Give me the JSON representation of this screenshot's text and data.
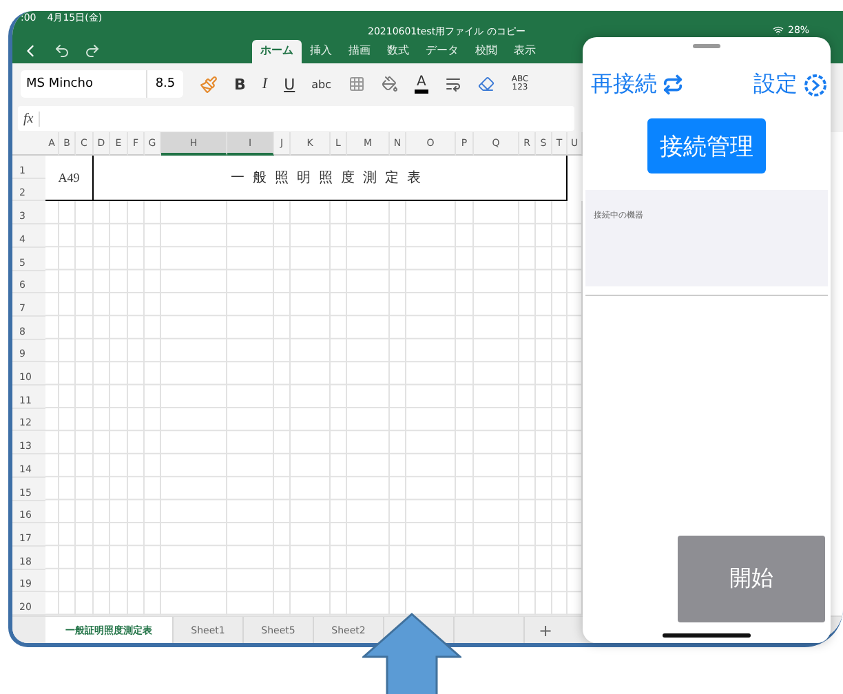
{
  "status_bar": {
    "time": ":00",
    "date": "4月15日(金)",
    "battery": "28%"
  },
  "document_title": "20210601test用ファイル のコピー",
  "ribbon_tabs": [
    {
      "label": "ホーム",
      "selected": true
    },
    {
      "label": "挿入",
      "selected": false
    },
    {
      "label": "描画",
      "selected": false
    },
    {
      "label": "数式",
      "selected": false
    },
    {
      "label": "データ",
      "selected": false
    },
    {
      "label": "校閲",
      "selected": false
    },
    {
      "label": "表示",
      "selected": false
    }
  ],
  "toolbar": {
    "font": "MS Mincho",
    "size": "8.5",
    "tools": [
      {
        "kind": "painter"
      },
      {
        "kind": "bold",
        "label": "B"
      },
      {
        "kind": "italic",
        "label": "I"
      },
      {
        "kind": "underline",
        "label": "U"
      },
      {
        "kind": "strike",
        "label": "abc"
      },
      {
        "kind": "borders"
      },
      {
        "kind": "fill"
      },
      {
        "kind": "font-color",
        "label": "A"
      },
      {
        "kind": "wrap"
      },
      {
        "kind": "clear"
      },
      {
        "kind": "number-format",
        "label": "ABC",
        "sublabel": "123"
      }
    ]
  },
  "formula_bar": {
    "label": "fx"
  },
  "sheet": {
    "columns": [
      {
        "label": "A",
        "selected": false
      },
      {
        "label": "B",
        "selected": false
      },
      {
        "label": "C",
        "selected": false
      },
      {
        "label": "D",
        "selected": false
      },
      {
        "label": "E",
        "selected": false
      },
      {
        "label": "F",
        "selected": false
      },
      {
        "label": "G",
        "selected": false
      },
      {
        "label": "H",
        "selected": true
      },
      {
        "label": "I",
        "selected": true
      },
      {
        "label": "J",
        "selected": false
      },
      {
        "label": "K",
        "selected": false
      },
      {
        "label": "L",
        "selected": false
      },
      {
        "label": "M",
        "selected": false
      },
      {
        "label": "N",
        "selected": false
      },
      {
        "label": "O",
        "selected": false
      },
      {
        "label": "P",
        "selected": false
      },
      {
        "label": "Q",
        "selected": false
      },
      {
        "label": "R",
        "selected": false
      },
      {
        "label": "S",
        "selected": false
      },
      {
        "label": "T",
        "selected": false
      },
      {
        "label": "U",
        "selected": false
      }
    ],
    "rows": [
      "1",
      "2",
      "3",
      "4",
      "5",
      "6",
      "7",
      "8",
      "9",
      "10",
      "11",
      "12",
      "13",
      "14",
      "15",
      "16",
      "17",
      "18",
      "19",
      "20"
    ],
    "code_cell": "A49",
    "title_cell": "一般照明照度測定表"
  },
  "sheet_tabs": [
    {
      "label": "一般証明照度測定表",
      "selected": true
    },
    {
      "label": "Sheet1",
      "selected": false
    },
    {
      "label": "Sheet5",
      "selected": false
    },
    {
      "label": "Sheet2",
      "selected": false
    }
  ],
  "add_sheet": "+",
  "panel": {
    "reconnect": "再接続",
    "settings": "設定",
    "manage_button": "接続管理",
    "connected_label": "接続中の機器",
    "start_button": "開始"
  }
}
